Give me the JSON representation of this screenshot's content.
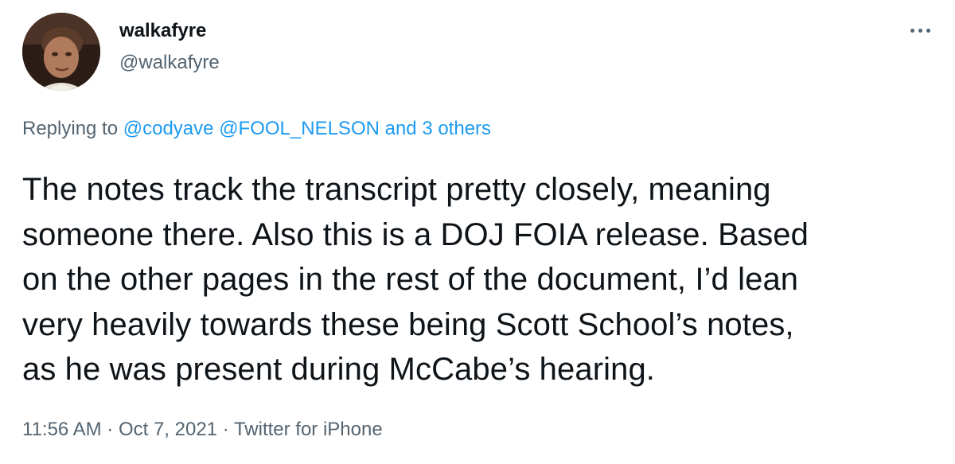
{
  "author": {
    "display_name": "walkafyre",
    "handle": "@walkafyre"
  },
  "reply": {
    "prefix": "Replying to",
    "mentions": [
      "@codyave",
      "@FOOL_NELSON"
    ],
    "others": "and 3 others"
  },
  "tweet": {
    "lines": [
      "The notes track the transcript pretty closely, meaning",
      "someone there. Also this is a DOJ FOIA release. Based",
      "on the other pages in the rest of the document, I’d lean",
      "very heavily towards these being Scott School’s notes,",
      "as he was present during McCabe’s hearing."
    ]
  },
  "meta": {
    "time": "11:56 AM",
    "separator": " · ",
    "date": "Oct 7, 2021",
    "source": "Twitter for iPhone"
  },
  "icons": {
    "more": "more-horizontal-icon",
    "avatar": "user-avatar"
  },
  "colors": {
    "text": "#0f1419",
    "secondary": "#536471",
    "link": "#1d9bf0",
    "background": "#ffffff"
  }
}
